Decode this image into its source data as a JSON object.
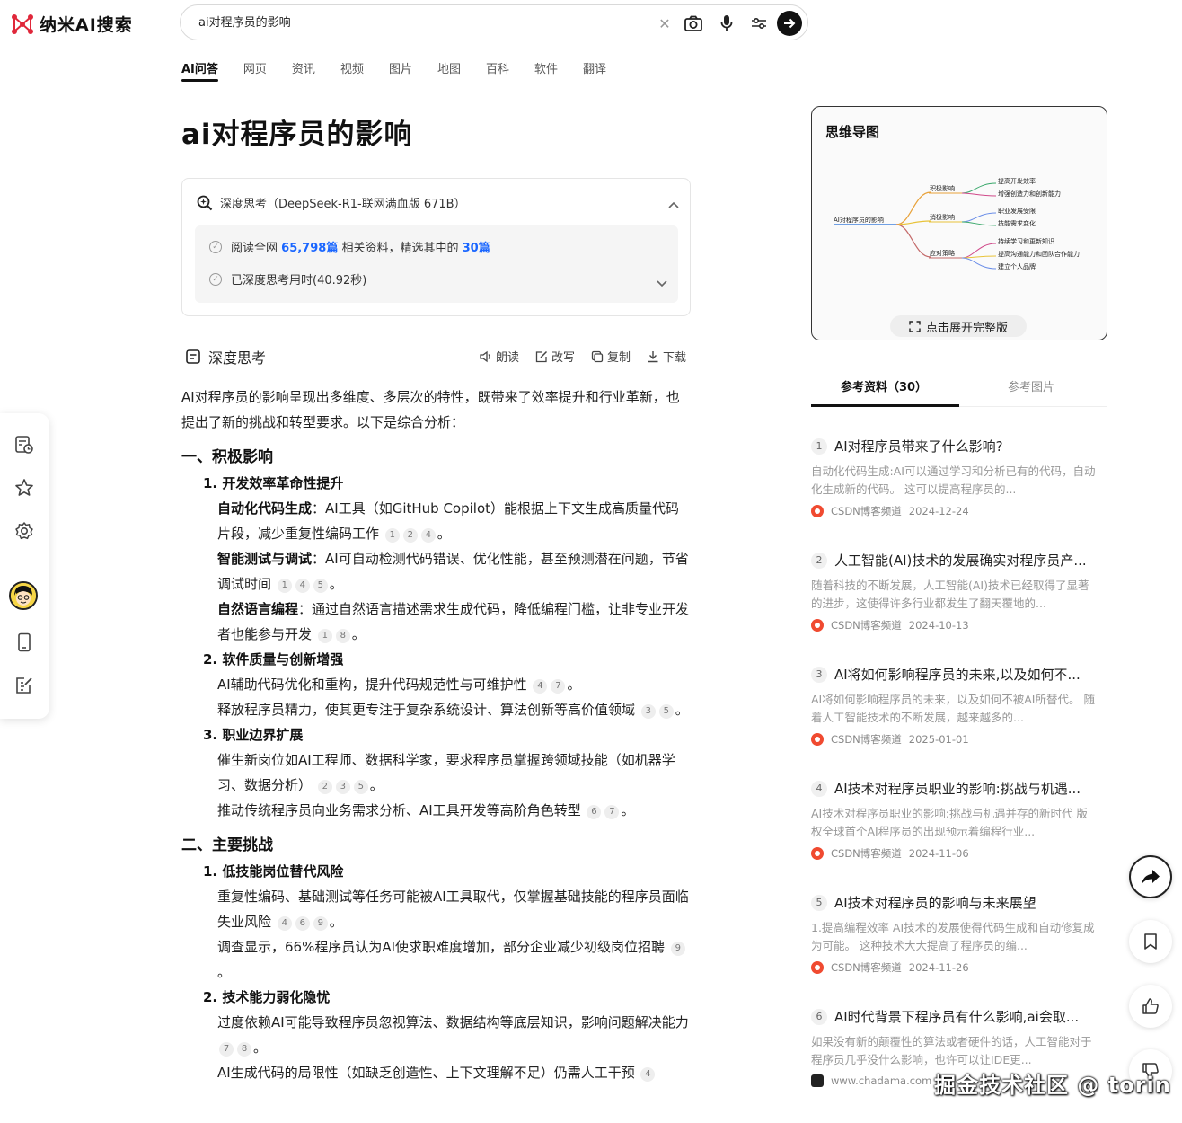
{
  "header": {
    "logo_text": "纳米AI搜索",
    "search_value": "ai对程序员的影响"
  },
  "tabs": [
    "AI问答",
    "网页",
    "资讯",
    "视频",
    "图片",
    "地图",
    "百科",
    "软件",
    "翻译"
  ],
  "active_tab": "AI问答",
  "page_title": "ai对程序员的影响",
  "deep_think": {
    "header": "深度思考（DeepSeek-R1-联网满血版 671B）",
    "read_prefix": "阅读全网",
    "read_count": "65,798篇",
    "read_middle": "相关资料，精选其中的",
    "read_selected": "30篇",
    "elapsed": "已深度思考用时(40.92秒)"
  },
  "section": {
    "title": "深度思考",
    "actions": [
      "朗读",
      "改写",
      "复制",
      "下载"
    ]
  },
  "answer": {
    "intro": "AI对程序员的影响呈现出多维度、多层次的特性，既带来了效率提升和行业革新，也提出了新的挑战和转型要求。以下是综合分析：",
    "h_positive": "一、积极影响",
    "p1": "1. 开发效率革命性提升",
    "p1_a_label": "自动化代码生成",
    "p1_a_text": "：AI工具（如GitHub Copilot）能根据上下文生成高质量代码片段，减少重复性编码工作",
    "p1_b_label": "智能测试与调试",
    "p1_b_text": "：AI可自动检测代码错误、优化性能，甚至预测潜在问题，节省调试时间",
    "p1_c_label": "自然语言编程",
    "p1_c_text": "：通过自然语言描述需求生成代码，降低编程门槛，让非专业开发者也能参与开发",
    "p2": "2. 软件质量与创新增强",
    "p2_a": "AI辅助代码优化和重构，提升代码规范性与可维护性",
    "p2_b": "释放程序员精力，使其更专注于复杂系统设计、算法创新等高价值领域",
    "p3": "3. 职业边界扩展",
    "p3_a": "催生新岗位如AI工程师、数据科学家，要求程序员掌握跨领域技能（如机器学习、数据分析）",
    "p3_b": "推动传统程序员向业务需求分析、AI工具开发等高阶角色转型",
    "h_challenge": "二、主要挑战",
    "c1": "1. 低技能岗位替代风险",
    "c1_a": "重复性编码、基础测试等任务可能被AI工具取代，仅掌握基础技能的程序员面临失业风险",
    "c1_b": "调查显示，66%程序员认为AI使求职难度增加，部分企业减少初级岗位招聘",
    "c2": "2. 技术能力弱化隐忧",
    "c2_a": "过度依赖AI可能导致程序员忽视算法、数据结构等底层知识，影响问题解决能力",
    "c2_b": "AI生成代码的局限性（如缺乏创造性、上下文理解不足）仍需人工干预",
    "cites": {
      "a": [
        "1",
        "2",
        "4"
      ],
      "b": [
        "1",
        "4",
        "5"
      ],
      "c": [
        "1",
        "8"
      ],
      "d": [
        "4",
        "7"
      ],
      "e": [
        "3",
        "5"
      ],
      "f": [
        "2",
        "3",
        "5"
      ],
      "g": [
        "6",
        "7"
      ],
      "h": [
        "4",
        "6",
        "9"
      ],
      "i": [
        "9"
      ],
      "j": [
        "7",
        "8"
      ],
      "k": [
        "4"
      ]
    }
  },
  "mindmap": {
    "title": "思维导图",
    "expand": "点击展开完整版",
    "root": "AI对程序员的影响",
    "branches": [
      {
        "name": "积极影响",
        "children": [
          "提高开发效率",
          "增强创造力和创新能力"
        ]
      },
      {
        "name": "消极影响",
        "children": [
          "职业发展受限",
          "技能需求变化"
        ]
      },
      {
        "name": "应对策略",
        "children": [
          "持续学习和更新知识",
          "提高沟通能力和团队合作能力",
          "建立个人品牌"
        ]
      }
    ]
  },
  "ref_tabs": [
    "参考资料（30）",
    "参考图片"
  ],
  "references": [
    {
      "num": "1",
      "title": "AI对程序员带来了什么影响?",
      "snippet": "自动化代码生成:AI可以通过学习和分析已有的代码，自动化生成新的代码。 这可以提高程序员的...",
      "source": "CSDN博客频道",
      "date": "2024-12-24"
    },
    {
      "num": "2",
      "title": "人工智能(AI)技术的发展确实对程序员产...",
      "snippet": "随着科技的不断发展，人工智能(AI)技术已经取得了显著的进步，这使得许多行业都发生了翻天覆地的...",
      "source": "CSDN博客频道",
      "date": "2024-10-13"
    },
    {
      "num": "3",
      "title": "AI将如何影响程序员的未来,以及如何不...",
      "snippet": "AI将如何影响程序员的未来，以及如何不被AI所替代。 随着人工智能技术的不断发展，越来越多的...",
      "source": "CSDN博客频道",
      "date": "2025-01-01"
    },
    {
      "num": "4",
      "title": "AI技术对程序员职业的影响:挑战与机遇...",
      "snippet": "AI技术对程序员职业的影响:挑战与机遇并存的新时代 版权全球首个AI程序员的出现预示着编程行业...",
      "source": "CSDN博客频道",
      "date": "2024-11-06"
    },
    {
      "num": "5",
      "title": "AI技术对程序员的影响与未来展望",
      "snippet": "1.提高编程效率 AI技术的发展使得代码生成和自动修复成为可能。 这种技术大大提高了程序员的编...",
      "source": "CSDN博客频道",
      "date": "2024-11-26"
    },
    {
      "num": "6",
      "title": "AI时代背景下程序员有什么影响,ai会取...",
      "snippet": "如果没有新的颠覆性的算法或者硬件的话，人工智能对于程序员几乎没什么影响，也许可以让IDE更...",
      "source": "www.chadama.com",
      "date": ""
    }
  ],
  "watermark": "掘金技术社区 @ torin"
}
